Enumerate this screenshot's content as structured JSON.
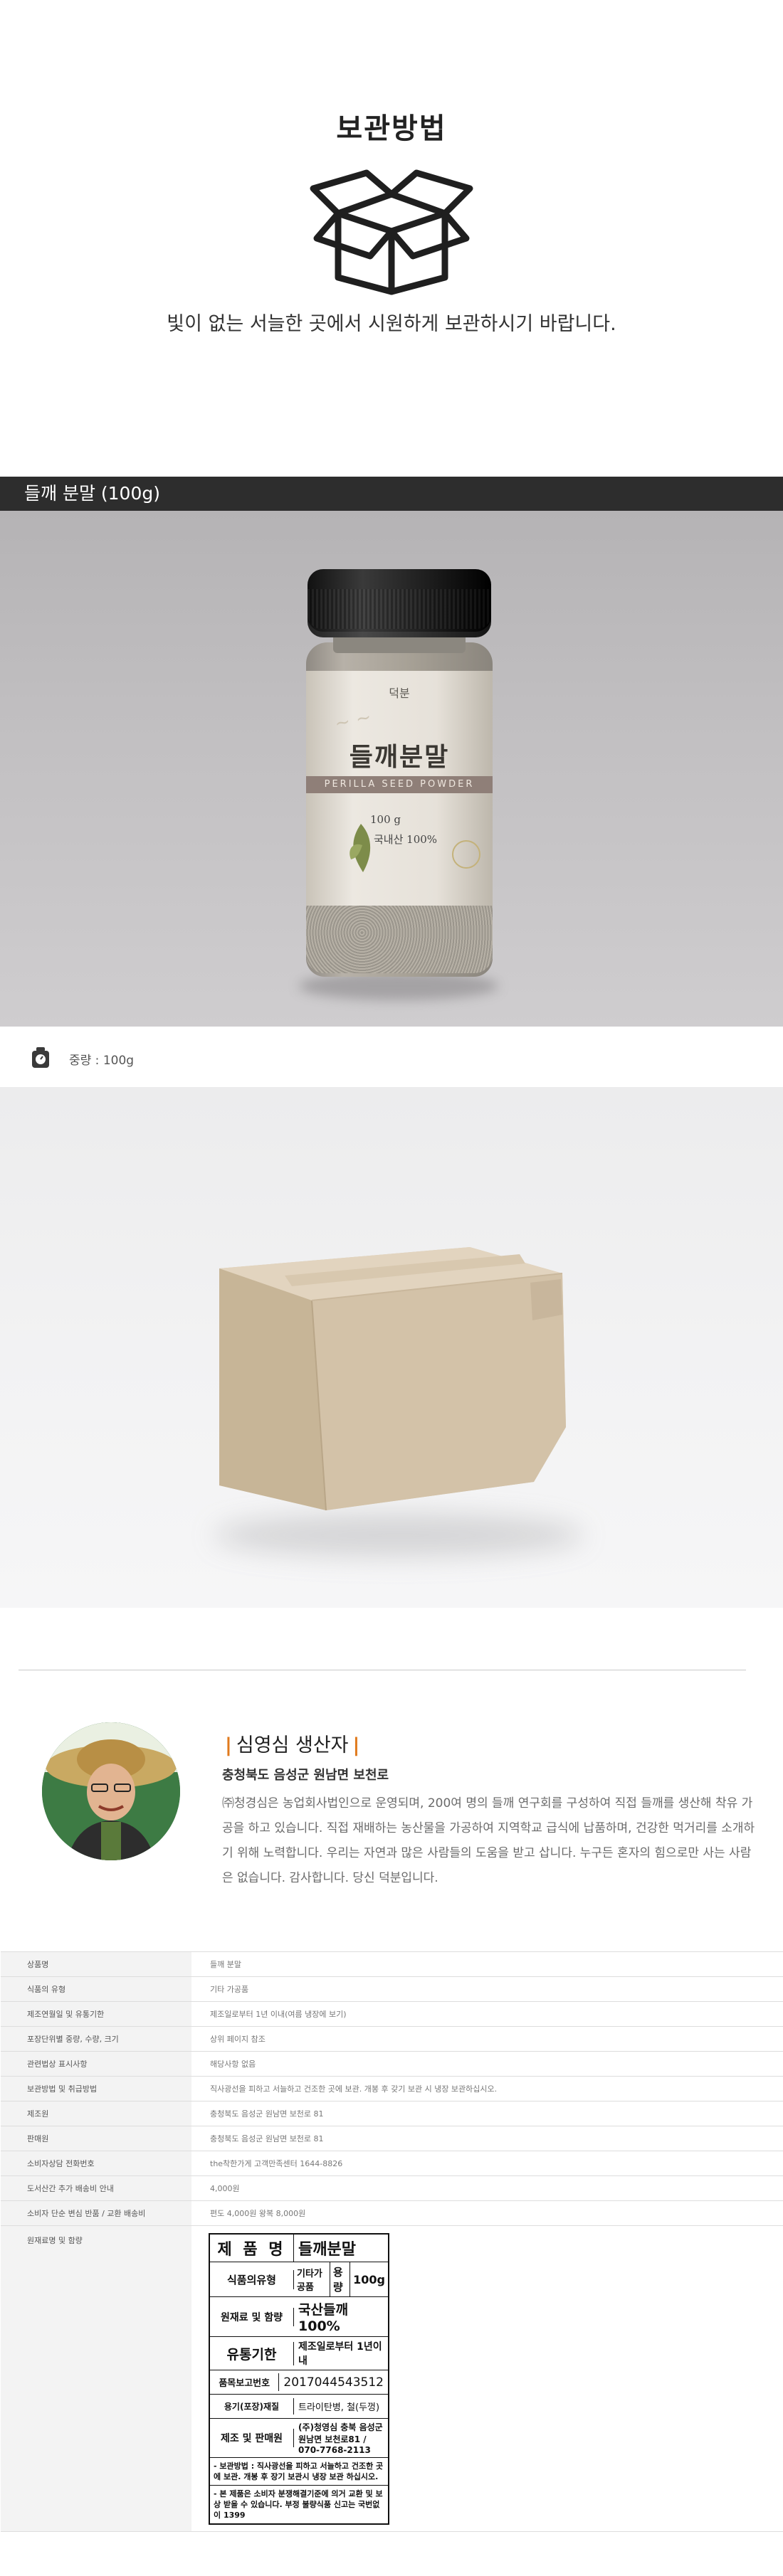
{
  "storage": {
    "title": "보관방법",
    "icon": "open-box-icon",
    "instruction": "빛이 없는 서늘한 곳에서 시원하게 보관하시기 바랍니다."
  },
  "product": {
    "header": "들깨 분말 (100g)",
    "jar_label": {
      "brand": "덕분",
      "title": "들깨분말",
      "strip": "PERILLA SEED POWDER",
      "weight": "100 g",
      "origin": "국내산 100%"
    },
    "weight_text": "중량 : 100g",
    "weight_icon": "scale-icon"
  },
  "producer": {
    "name": "심영심 생산자",
    "address": "충청북도 음성군 원남면 보천로",
    "description": "㈜청경심은 농업회사법인으로 운영되며, 200여 명의 들깨 연구회를 구성하여 직접 들깨를 생산해 착유 가공을 하고 있습니다. 직접 재배하는 농산물을 가공하여 지역학교 급식에 납품하며, 건강한 먹거리를 소개하기 위해 노력합니다. 우리는 자연과 많은 사람들의 도움을 받고 삽니다. 누구든 혼자의 힘으로만 사는 사람은 없습니다. 감사합니다. 당신 덕분입니다.",
    "accent_color": "#e07a1d"
  },
  "info_table": [
    {
      "key": "상품명",
      "value": "들깨 분말"
    },
    {
      "key": "식품의 유형",
      "value": "기타 가공품"
    },
    {
      "key": "제조연월일 및 유통기한",
      "value": "제조일로부터 1년 이내(여름 냉장에 보기)"
    },
    {
      "key": "포장단위별 중량, 수량, 크기",
      "value": "상위 페이지 참조"
    },
    {
      "key": "관련법상 표시사항",
      "value": "해당사항 없음"
    },
    {
      "key": "보관방법 및 취급방법",
      "value": "직사광선을 피하고 서늘하고 건조한 곳에 보관. 개봉 후 갖기 보관 시 냉장 보관하십시오."
    },
    {
      "key": "제조원",
      "value": "충청북도 음성군 원남면 보천로 81"
    },
    {
      "key": "판매원",
      "value": "충청북도 음성군 원남면 보천로 81"
    },
    {
      "key": "소비자상담 전화번호",
      "value": "the착한가게 고객만족센터 1644-8826"
    },
    {
      "key": "도서산간 추가 배송비 안내",
      "value": "4,000원"
    },
    {
      "key": "소비자 단순 변심 반품 / 교환 배송비",
      "value": "편도 4,000원 왕복 8,000원"
    },
    {
      "key": "원재료명 및 함량",
      "value": ""
    }
  ],
  "nutrition_label": {
    "product_name_label": "제 품 명",
    "product_name": "들깨분말",
    "type_label": "식품의유형",
    "type_value": "기타가공품",
    "capacity_label": "용량",
    "capacity_value": "100g",
    "ingredients_label": "원재료 및 함량",
    "ingredients_value": "국산들깨 100%",
    "expiry_label": "유통기한",
    "expiry_value": "제조일로부터 1년이내",
    "report_label": "품목보고번호",
    "report_value": "2017044543512",
    "package_label": "용기(포장)재질",
    "package_value": "트라이탄병, 철(두껑)",
    "maker_label": "제조 및 판매원",
    "maker_value": "(주)청영심 충북 음성군 원남면 보천로81 / 070-7768-2113",
    "storage_note": "- 보관방법 : 직사광선을 피하고 서늘하고 건조한 곳에 보관. 개봉 후 장기 보관시 냉장 보관 하십시오.",
    "notice_note": "- 본 제품은 소비자 분쟁해결기준에 의거 교환 및 보상 받을 수 있습니다. 부정 불량식품 신고는 국번없이 1399"
  }
}
